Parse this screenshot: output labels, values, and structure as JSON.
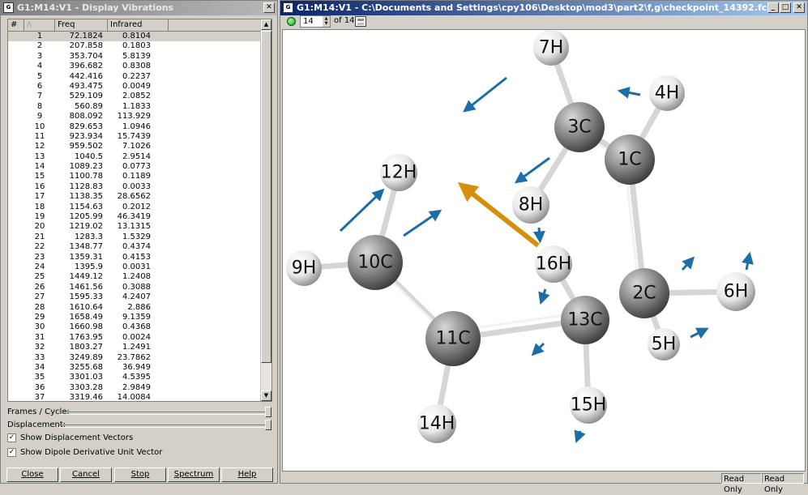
{
  "left_window": {
    "title": "G1:M14:V1 - Display Vibrations",
    "icon": "gaussview-icon",
    "columns": [
      "#",
      "Freq",
      "Infrared"
    ],
    "sort_indicator": "/\\",
    "rows": [
      [
        "1",
        "72.1824",
        "0.8104"
      ],
      [
        "2",
        "207.858",
        "0.1803"
      ],
      [
        "3",
        "353.704",
        "5.8139"
      ],
      [
        "4",
        "396.682",
        "0.8308"
      ],
      [
        "5",
        "442.416",
        "0.2237"
      ],
      [
        "6",
        "493.475",
        "0.0049"
      ],
      [
        "7",
        "529.109",
        "2.0852"
      ],
      [
        "8",
        "560.89",
        "1.1833"
      ],
      [
        "9",
        "808.092",
        "113.929"
      ],
      [
        "10",
        "829.653",
        "1.0946"
      ],
      [
        "11",
        "923.934",
        "15.7439"
      ],
      [
        "12",
        "959.502",
        "7.1026"
      ],
      [
        "13",
        "1040.5",
        "2.9514"
      ],
      [
        "14",
        "1089.23",
        "0.0773"
      ],
      [
        "15",
        "1100.78",
        "0.1189"
      ],
      [
        "16",
        "1128.83",
        "0.0033"
      ],
      [
        "17",
        "1138.35",
        "28.6562"
      ],
      [
        "18",
        "1154.63",
        "0.2012"
      ],
      [
        "19",
        "1205.99",
        "46.3419"
      ],
      [
        "20",
        "1219.02",
        "13.1315"
      ],
      [
        "21",
        "1283.3",
        "1.5329"
      ],
      [
        "22",
        "1348.77",
        "0.4374"
      ],
      [
        "23",
        "1359.31",
        "0.4153"
      ],
      [
        "24",
        "1395.9",
        "0.0031"
      ],
      [
        "25",
        "1449.12",
        "1.2408"
      ],
      [
        "26",
        "1461.56",
        "0.3088"
      ],
      [
        "27",
        "1595.33",
        "4.2407"
      ],
      [
        "28",
        "1610.64",
        "2.886"
      ],
      [
        "29",
        "1658.49",
        "9.1359"
      ],
      [
        "30",
        "1660.98",
        "0.4368"
      ],
      [
        "31",
        "1763.95",
        "0.0024"
      ],
      [
        "32",
        "1803.27",
        "1.2491"
      ],
      [
        "33",
        "3249.89",
        "23.7862"
      ],
      [
        "34",
        "3255.68",
        "36.949"
      ],
      [
        "35",
        "3301.03",
        "4.5395"
      ],
      [
        "36",
        "3303.28",
        "2.9849"
      ],
      [
        "37",
        "3319.46",
        "14.0084"
      ]
    ],
    "selected_row": 1,
    "frames_label": "Frames / Cycle:",
    "displacement_label": "Displacement:",
    "frames_value": 1.0,
    "displacement_value": 1.0,
    "show_vectors_label": "Show Displacement Vectors",
    "show_vectors_checked": true,
    "show_dipole_label": "Show Dipole Derivative Unit Vector",
    "show_dipole_checked": true,
    "buttons": [
      "Close",
      "Cancel",
      "Stop",
      "Spectrum",
      "Help"
    ],
    "button_mnemonics": [
      "C",
      "a",
      "S",
      "p",
      "H"
    ]
  },
  "right_window": {
    "title": "G1:M14:V1 - C:\\Documents and Settings\\cpy106\\Desktop\\mod3\\part2\\f,g\\checkpoint_14392.fchk",
    "frame_value": "14",
    "frame_of": "of 14",
    "status": [
      "Read Only",
      "Read Only"
    ],
    "atoms": [
      {
        "label": "7H",
        "type": "H"
      },
      {
        "label": "4H",
        "type": "H"
      },
      {
        "label": "3C",
        "type": "C"
      },
      {
        "label": "1C",
        "type": "C"
      },
      {
        "label": "12H",
        "type": "H"
      },
      {
        "label": "8H",
        "type": "H"
      },
      {
        "label": "16H",
        "type": "H"
      },
      {
        "label": "9H",
        "type": "H"
      },
      {
        "label": "10C",
        "type": "C"
      },
      {
        "label": "2C",
        "type": "C"
      },
      {
        "label": "6H",
        "type": "H"
      },
      {
        "label": "13C",
        "type": "C"
      },
      {
        "label": "11C",
        "type": "C"
      },
      {
        "label": "5H",
        "type": "H"
      },
      {
        "label": "15H",
        "type": "H"
      },
      {
        "label": "14H",
        "type": "H"
      }
    ],
    "colors": {
      "hydrogen": "#e8e8e8",
      "carbon": "#7a7a7a",
      "vector": "#1d6ea8",
      "dipole": "#d4900a",
      "bond": "#d8d8d8"
    }
  }
}
